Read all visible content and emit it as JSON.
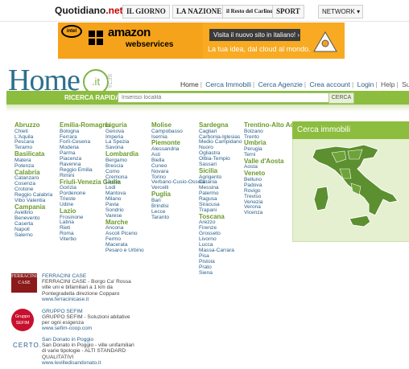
{
  "network_bar": {
    "quotidiano": "Quotidiano",
    "quotidiano_tld": ".net",
    "links": [
      "IL GIORNO",
      "LA NAZIONE",
      "il Resto del Carlino",
      "SPORT",
      "NETWORK"
    ]
  },
  "ad": {
    "intel": "intel",
    "brand": "amazon",
    "brand_sub": "webservices",
    "cta": "Visita il nuovo sito in italiano!",
    "tagline": "La tua idea, dal cloud al mondo."
  },
  "header": {
    "logo_text": "Home",
    "logo_domain": ".it",
    "logo_beta": "BETA",
    "nav": [
      "Home",
      "Cerca Immobili",
      "Cerca Agenzie",
      "Crea account",
      "Login",
      "Help",
      "Su di noi"
    ]
  },
  "search": {
    "label": "RICERCA RAPIDA",
    "placeholder": "Inserisci località",
    "button": "CERCA"
  },
  "regions": [
    [
      {
        "name": "Abruzzo",
        "cities": [
          "Chieti",
          "L'Aquila",
          "Pescara",
          "Teramo"
        ]
      },
      {
        "name": "Basilicata",
        "cities": [
          "Matera",
          "Potenza"
        ]
      },
      {
        "name": "Calabria",
        "cities": [
          "Catanzaro",
          "Cosenza",
          "Crotone",
          "Reggio Calabria",
          "Vibo Valentia"
        ]
      },
      {
        "name": "Campania",
        "cities": [
          "Avellino",
          "Benevento",
          "Caserta",
          "Napoli",
          "Salerno"
        ]
      }
    ],
    [
      {
        "name": "Emilia-Romagna",
        "cities": [
          "Bologna",
          "Ferrara",
          "Forlì-Cesena",
          "Modena",
          "Parma",
          "Piacenza",
          "Ravenna",
          "Reggio Emilia",
          "Rimini"
        ]
      },
      {
        "name": "Friuli-Venezia Giulia",
        "cities": [
          "Gorizia",
          "Pordenone",
          "Trieste",
          "Udine"
        ]
      },
      {
        "name": "Lazio",
        "cities": [
          "Frosinone",
          "Latina",
          "Rieti",
          "Roma",
          "Viterbo"
        ]
      }
    ],
    [
      {
        "name": "Liguria",
        "cities": [
          "Genova",
          "Imperia",
          "La Spezia",
          "Savona"
        ]
      },
      {
        "name": "Lombardia",
        "cities": [
          "Bergamo",
          "Brescia",
          "Como",
          "Cremona",
          "Lecco",
          "Lodi",
          "Mantova",
          "Milano",
          "Pavia",
          "Sondrio",
          "Varese"
        ]
      },
      {
        "name": "Marche",
        "cities": [
          "Ancona",
          "Ascoli Piceno",
          "Fermo",
          "Macerata",
          "Pesaro e Urbino"
        ]
      }
    ],
    [
      {
        "name": "Molise",
        "cities": [
          "Campobasso",
          "Isernia"
        ]
      },
      {
        "name": "Piemonte",
        "cities": [
          "Alessandria",
          "Asti",
          "Biella",
          "Cuneo",
          "Novara",
          "Torino",
          "Verbano-Cusio-Ossola",
          "Vercelli"
        ]
      },
      {
        "name": "Puglia",
        "cities": [
          "Bari",
          "Brindisi",
          "Lecce",
          "Taranto"
        ]
      }
    ],
    [
      {
        "name": "Sardegna",
        "cities": [
          "Cagliari",
          "Carbonia-Iglesias",
          "Medio Campidano",
          "Nuoro",
          "Ogliastra",
          "Olbia-Tempio",
          "Sassari"
        ]
      },
      {
        "name": "Sicilia",
        "cities": [
          "Agrigento",
          "Catania",
          "Messina",
          "Palermo",
          "Ragusa",
          "Siracusa",
          "Trapani"
        ]
      },
      {
        "name": "Toscana",
        "cities": [
          "Arezzo",
          "Firenze",
          "Grosseto",
          "Livorno",
          "Lucca",
          "Massa-Carrara",
          "Pisa",
          "Pistoia",
          "Prato",
          "Siena"
        ]
      }
    ],
    [
      {
        "name": "Trentino-Alto Adige",
        "cities": [
          "Bolzano",
          "Trento"
        ]
      },
      {
        "name": "Umbria",
        "cities": [
          "Perugia",
          "Terni"
        ]
      },
      {
        "name": "Valle d'Aosta",
        "cities": [
          "Aosta"
        ]
      },
      {
        "name": "Veneto",
        "cities": [
          "Belluno",
          "Padova",
          "Rovigo",
          "Treviso",
          "Venezia",
          "Verona",
          "Vicenza"
        ]
      }
    ]
  ],
  "map_panel": {
    "title": "Cerca immobili"
  },
  "sponsors": [
    {
      "logo": "FERRACINI CASE",
      "title": "FERRACINI CASE",
      "desc": "FERRACINI CASE - Borgo Ca' Rossa ville uni e bifamiliari a 1 km da Pontegradella direzione Copparo",
      "url": "www.ferracinicase.it"
    },
    {
      "logo": "Gruppo SEFIM",
      "title": "GRUPPO SEFIM",
      "desc": "GRUPPO SEFIM - Soluzioni abitative per ogni esigenza",
      "url": "www.sefim-coop.com"
    },
    {
      "logo": "CERTO.",
      "title": "San Donato in Poggio",
      "desc": "San Donato in Poggio - ville unifamiliari di varie tipologie - ALTI STANDARD QUALITATIVI",
      "url": "www.levilledisandonato.it"
    }
  ],
  "colors": {
    "brand_green": "#8cbd3f",
    "brand_blue": "#2d6f8e",
    "link_blue": "#2a5f8a",
    "ad_orange": "#f5a31b"
  }
}
